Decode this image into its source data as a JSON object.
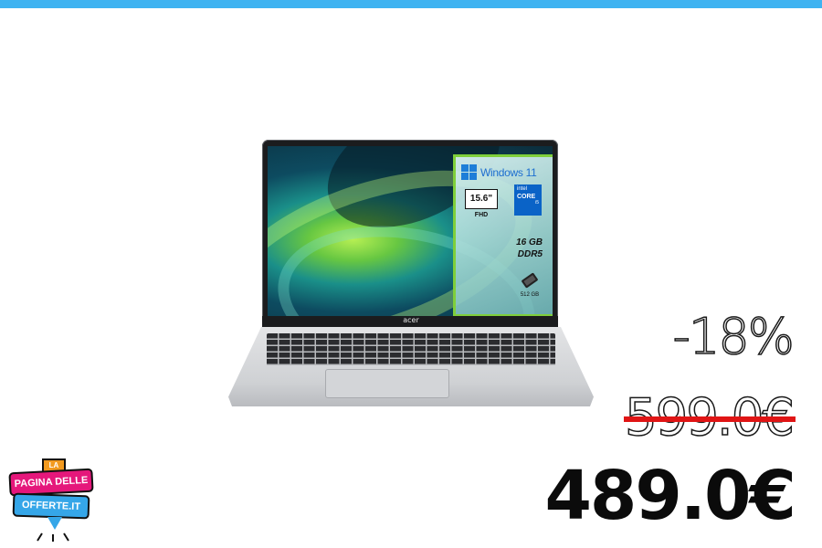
{
  "product": {
    "lid_brand": "acer",
    "panel": {
      "os": "Windows 11",
      "screen_size": "15.6\"",
      "screen_type": "FHD",
      "cpu_brand": "intel",
      "cpu_line": "CORE",
      "cpu_tier": "i5",
      "ram_size": "16 GB",
      "ram_type": "DDR5",
      "storage_icon": "ssd-icon",
      "storage_size": "512 GB"
    }
  },
  "pricing": {
    "discount": "-18%",
    "old_price": "599.0€",
    "new_price": "489.0€"
  },
  "site_logo": {
    "small_tag": "LA",
    "line1": "PAGINA DELLE",
    "line2": "OFFERTE.IT"
  },
  "colors": {
    "top_bar": "#3fb3f1",
    "strike": "#e01515",
    "logo_pink": "#e5177b",
    "logo_blue": "#35a6e8",
    "logo_orange": "#f29a1f",
    "panel_border": "#7fcf3b"
  }
}
